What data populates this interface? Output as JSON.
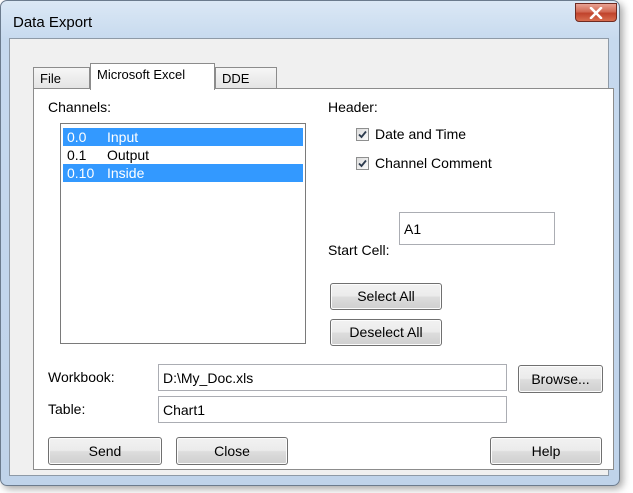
{
  "window": {
    "title": "Data Export"
  },
  "tabs": [
    {
      "label": "File"
    },
    {
      "label": "Microsoft Excel"
    },
    {
      "label": "DDE"
    }
  ],
  "channels": {
    "label": "Channels:",
    "items": [
      {
        "number": "0.0",
        "name": "Input",
        "selected": true
      },
      {
        "number": "0.1",
        "name": "Output",
        "selected": false
      },
      {
        "number": "0.10",
        "name": "Inside",
        "selected": true
      }
    ]
  },
  "header": {
    "label": "Header:",
    "date_time": {
      "label": "Date and Time",
      "checked": true
    },
    "channel_comment": {
      "label": "Channel Comment",
      "checked": true
    }
  },
  "start_cell": {
    "label": "Start Cell:",
    "value": "A1"
  },
  "buttons": {
    "select_all": "Select All",
    "deselect_all": "Deselect All",
    "browse": "Browse...",
    "send": "Send",
    "close": "Close",
    "help": "Help"
  },
  "workbook": {
    "label": "Workbook:",
    "value": "D:\\My_Doc.xls"
  },
  "table": {
    "label": "Table:",
    "value": "Chart1"
  },
  "colors": {
    "selection": "#3399ff",
    "close_button": "#c0432c"
  }
}
